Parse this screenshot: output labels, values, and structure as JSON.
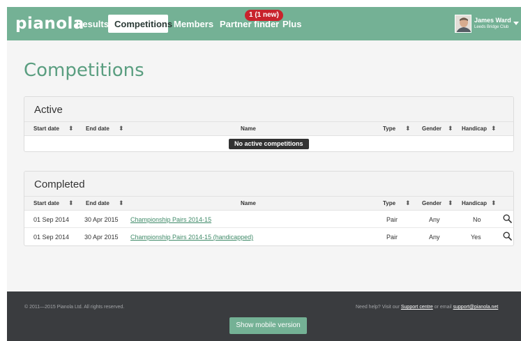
{
  "header": {
    "logo": "pianola",
    "nav": [
      {
        "label": "Results"
      },
      {
        "label": "Competitions",
        "active": true
      },
      {
        "label": "Members"
      },
      {
        "label": "Partner finder"
      },
      {
        "label": "Plus"
      }
    ],
    "partner_badge": "1 (1 new)",
    "user": {
      "name": "James Ward",
      "club": "Leeds Bridge Club"
    }
  },
  "page": {
    "title": "Competitions"
  },
  "columns": {
    "start": "Start date",
    "end": "End date",
    "name": "Name",
    "type": "Type",
    "gender": "Gender",
    "handicap": "Handicap",
    "sort_glyph": "⬍"
  },
  "active": {
    "title": "Active",
    "empty_text": "No active competitions"
  },
  "completed": {
    "title": "Completed",
    "rows": [
      {
        "start": "01 Sep 2014",
        "end": "30 Apr 2015",
        "name": "Championship Pairs 2014-15",
        "type": "Pair",
        "gender": "Any",
        "handicap": "No"
      },
      {
        "start": "01 Sep 2014",
        "end": "30 Apr 2015",
        "name": "Championship Pairs 2014-15 (handicapped)",
        "type": "Pair",
        "gender": "Any",
        "handicap": "Yes"
      }
    ]
  },
  "footer": {
    "copyright": "© 2011—2015 Pianola Ltd. All rights reserved.",
    "help_prefix": "Need help? Visit our ",
    "support_link": "Support centre",
    "help_mid": " or email ",
    "email": "support@pianola.net",
    "mobile_button": "Show mobile version"
  },
  "icons": {
    "search": "magnifier-icon",
    "caret": "caret-down-icon",
    "sort": "sort-icon"
  },
  "colors": {
    "brand": "#74b195",
    "title_green": "#5a9e80",
    "badge_red": "#c8232c",
    "footer_bg": "#3a3c3f"
  }
}
